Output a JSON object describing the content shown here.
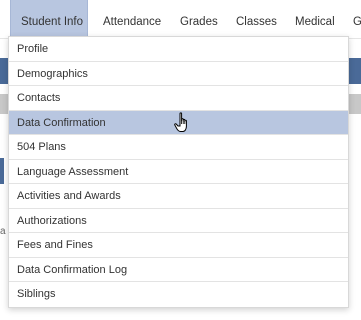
{
  "nav": {
    "items": [
      {
        "label": "Student Info",
        "active": true
      },
      {
        "label": "Attendance",
        "active": false
      },
      {
        "label": "Grades",
        "active": false
      },
      {
        "label": "Classes",
        "active": false
      },
      {
        "label": "Medical",
        "active": false
      },
      {
        "label": "G",
        "active": false
      }
    ]
  },
  "menu": {
    "items": [
      {
        "label": "Profile"
      },
      {
        "label": "Demographics"
      },
      {
        "label": "Contacts"
      },
      {
        "label": "Data Confirmation",
        "hovered": true
      },
      {
        "label": "504 Plans"
      },
      {
        "label": "Language Assessment"
      },
      {
        "label": "Activities and Awards"
      },
      {
        "label": "Authorizations"
      },
      {
        "label": "Fees and Fines"
      },
      {
        "label": "Data Confirmation Log"
      },
      {
        "label": "Siblings"
      }
    ]
  },
  "background": {
    "partial_char": "a"
  },
  "colors": {
    "active_bg": "#b8c6e0",
    "background_blue": "#4a6a98",
    "background_gray": "#c8c8c8"
  },
  "cursor_icon": "hand-pointer-icon"
}
